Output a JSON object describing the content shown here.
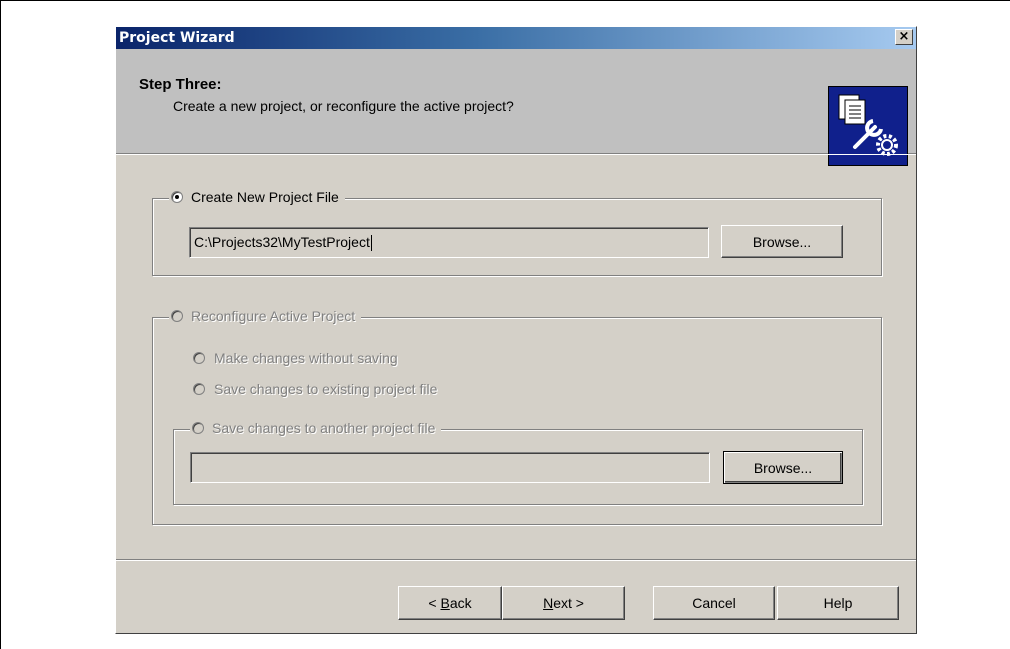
{
  "window": {
    "title": "Project Wizard",
    "close_glyph": "×"
  },
  "header": {
    "step_title": "Step Three:",
    "step_description": "Create a new project, or reconfigure the active project?",
    "icon": "project-settings-icon"
  },
  "create_group": {
    "label": "Create New Project File",
    "selected": true,
    "path_value": "C:\\Projects32\\MyTestProject",
    "browse_label": "Browse..."
  },
  "reconfigure_group": {
    "label": "Reconfigure Active Project",
    "enabled": false,
    "options": [
      {
        "label": "Make changes without saving"
      },
      {
        "label": "Save changes to existing project file"
      }
    ],
    "another_file": {
      "label": "Save changes to another project file",
      "path_value": "",
      "browse_label": "Browse..."
    }
  },
  "footer": {
    "back_prefix": "< ",
    "back_key": "B",
    "back_rest": "ack",
    "next_key": "N",
    "next_rest": "ext >",
    "cancel_label": "Cancel",
    "help_label": "Help"
  },
  "colors": {
    "titlebar_start": "#0a246a",
    "titlebar_end": "#a6caf0",
    "dialog_bg": "#d4d0c8",
    "header_bg": "#c0c0c0"
  }
}
